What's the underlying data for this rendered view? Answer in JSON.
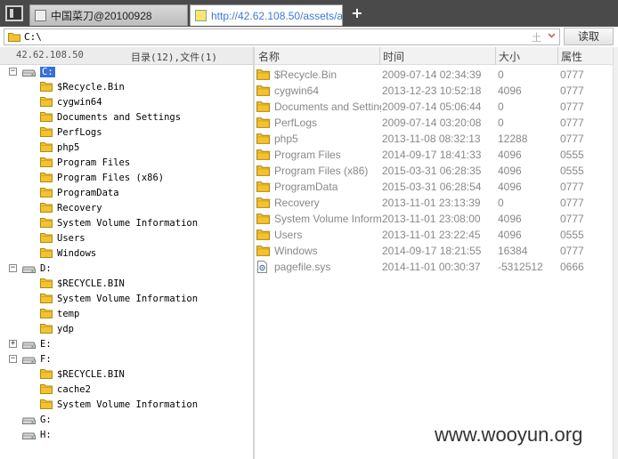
{
  "tabs": [
    {
      "label": "中国菜刀@20100928"
    },
    {
      "label": "http://42.62.108.50/assets/a..."
    }
  ],
  "new_tab_label": "+",
  "address": {
    "path": "C:\\",
    "upload_glyph": "土",
    "read_label": "读取"
  },
  "left_header": {
    "ip": "42.62.108.50",
    "count": "目录(12),文件(1)"
  },
  "right_header": {
    "name": "名称",
    "time": "时间",
    "size": "大小",
    "attr": "属性"
  },
  "tree": [
    {
      "kind": "drive",
      "label": "C:",
      "expander": "−",
      "selected": true
    },
    {
      "kind": "folder",
      "label": "$Recycle.Bin"
    },
    {
      "kind": "folder",
      "label": "cygwin64"
    },
    {
      "kind": "folder",
      "label": "Documents and Settings"
    },
    {
      "kind": "folder",
      "label": "PerfLogs"
    },
    {
      "kind": "folder",
      "label": "php5"
    },
    {
      "kind": "folder",
      "label": "Program Files"
    },
    {
      "kind": "folder",
      "label": "Program Files (x86)"
    },
    {
      "kind": "folder",
      "label": "ProgramData"
    },
    {
      "kind": "folder",
      "label": "Recovery"
    },
    {
      "kind": "folder",
      "label": "System Volume Information"
    },
    {
      "kind": "folder",
      "label": "Users"
    },
    {
      "kind": "folder",
      "label": "Windows"
    },
    {
      "kind": "drive",
      "label": "D:",
      "expander": "−"
    },
    {
      "kind": "folder",
      "label": "$RECYCLE.BIN"
    },
    {
      "kind": "folder",
      "label": "System Volume Information"
    },
    {
      "kind": "folder",
      "label": "temp"
    },
    {
      "kind": "folder",
      "label": "ydp"
    },
    {
      "kind": "drive",
      "label": "E:",
      "expander": "+"
    },
    {
      "kind": "drive",
      "label": "F:",
      "expander": "−"
    },
    {
      "kind": "folder",
      "label": "$RECYCLE.BIN"
    },
    {
      "kind": "folder",
      "label": "cache2"
    },
    {
      "kind": "folder",
      "label": "System Volume Information"
    },
    {
      "kind": "drive",
      "label": "G:"
    },
    {
      "kind": "drive",
      "label": "H:"
    }
  ],
  "files": [
    {
      "type": "folder",
      "name": "$Recycle.Bin",
      "time": "2009-07-14 02:34:39",
      "size": "0",
      "attr": "0777"
    },
    {
      "type": "folder",
      "name": "cygwin64",
      "time": "2013-12-23 10:52:18",
      "size": "4096",
      "attr": "0777"
    },
    {
      "type": "folder",
      "name": "Documents and Settings",
      "time": "2009-07-14 05:06:44",
      "size": "0",
      "attr": "0777"
    },
    {
      "type": "folder",
      "name": "PerfLogs",
      "time": "2009-07-14 03:20:08",
      "size": "0",
      "attr": "0777"
    },
    {
      "type": "folder",
      "name": "php5",
      "time": "2013-11-08 08:32:13",
      "size": "12288",
      "attr": "0777"
    },
    {
      "type": "folder",
      "name": "Program Files",
      "time": "2014-09-17 18:41:33",
      "size": "4096",
      "attr": "0555"
    },
    {
      "type": "folder",
      "name": "Program Files (x86)",
      "time": "2015-03-31 06:28:35",
      "size": "4096",
      "attr": "0555"
    },
    {
      "type": "folder",
      "name": "ProgramData",
      "time": "2015-03-31 06:28:54",
      "size": "4096",
      "attr": "0777"
    },
    {
      "type": "folder",
      "name": "Recovery",
      "time": "2013-11-01 23:13:39",
      "size": "0",
      "attr": "0777"
    },
    {
      "type": "folder",
      "name": "System Volume Inform...",
      "time": "2013-11-01 23:08:00",
      "size": "4096",
      "attr": "0777"
    },
    {
      "type": "folder",
      "name": "Users",
      "time": "2013-11-01 23:22:45",
      "size": "4096",
      "attr": "0555"
    },
    {
      "type": "folder",
      "name": "Windows",
      "time": "2014-09-17 18:21:55",
      "size": "16384",
      "attr": "0777"
    },
    {
      "type": "file",
      "name": "pagefile.sys",
      "time": "2014-11-01 00:30:37",
      "size": "-5312512",
      "attr": "0666"
    }
  ],
  "watermark": "www.wooyun.org",
  "colors": {
    "folder": "#f2c230",
    "selection": "#3a6fd8",
    "tabbar": "#4a4a4a",
    "active_tab_text": "#3a7bd5"
  }
}
